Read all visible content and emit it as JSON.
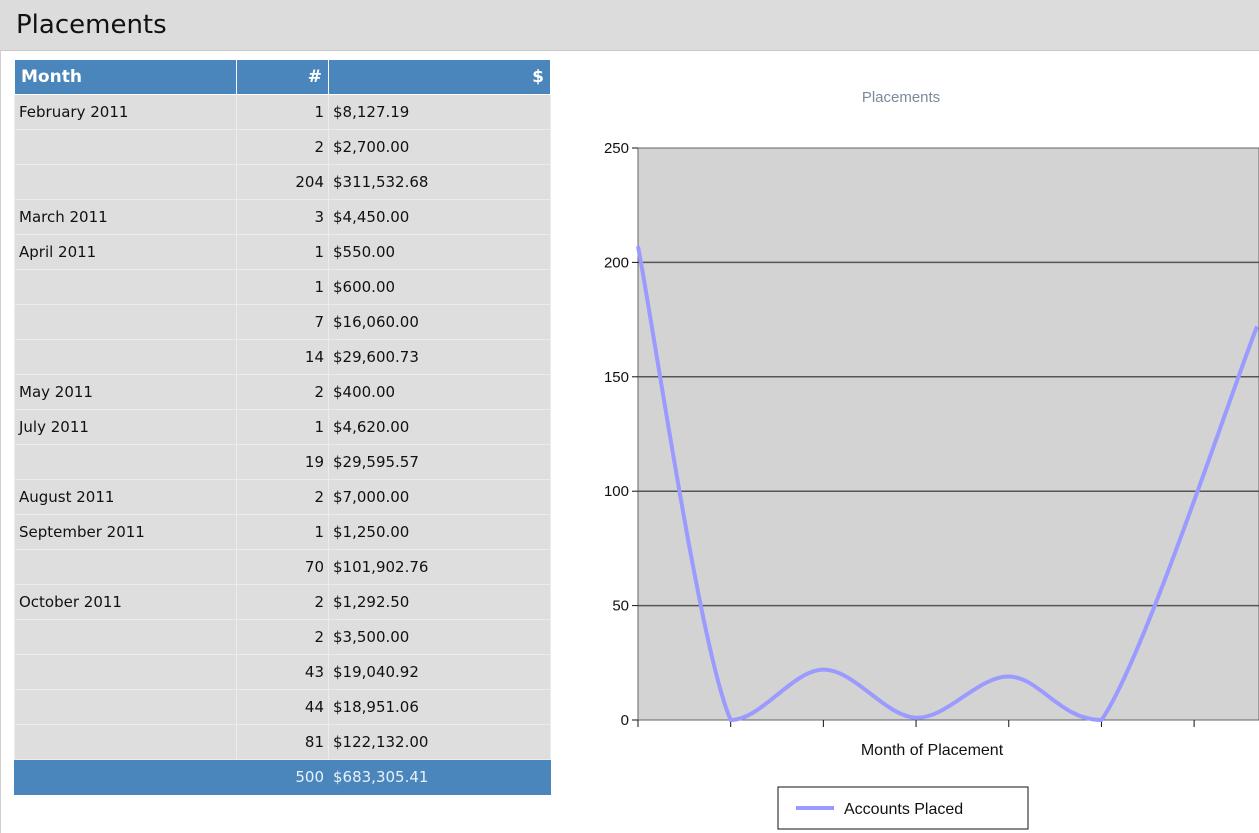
{
  "page": {
    "title": "Placements"
  },
  "table": {
    "headers": {
      "month": "Month",
      "count": "#",
      "amount": "$"
    },
    "rows": [
      {
        "month": "February 2011",
        "count": "1",
        "amount": "$8,127.19"
      },
      {
        "month": "",
        "count": "2",
        "amount": "$2,700.00"
      },
      {
        "month": "",
        "count": "204",
        "amount": "$311,532.68"
      },
      {
        "month": "March 2011",
        "count": "3",
        "amount": "$4,450.00"
      },
      {
        "month": "April 2011",
        "count": "1",
        "amount": "$550.00"
      },
      {
        "month": "",
        "count": "1",
        "amount": "$600.00"
      },
      {
        "month": "",
        "count": "7",
        "amount": "$16,060.00"
      },
      {
        "month": "",
        "count": "14",
        "amount": "$29,600.73"
      },
      {
        "month": "May 2011",
        "count": "2",
        "amount": "$400.00"
      },
      {
        "month": "July 2011",
        "count": "1",
        "amount": "$4,620.00"
      },
      {
        "month": "",
        "count": "19",
        "amount": "$29,595.57"
      },
      {
        "month": "August 2011",
        "count": "2",
        "amount": "$7,000.00"
      },
      {
        "month": "September 2011",
        "count": "1",
        "amount": "$1,250.00"
      },
      {
        "month": "",
        "count": "70",
        "amount": "$101,902.76"
      },
      {
        "month": "October 2011",
        "count": "2",
        "amount": "$1,292.50"
      },
      {
        "month": "",
        "count": "2",
        "amount": "$3,500.00"
      },
      {
        "month": "",
        "count": "43",
        "amount": "$19,040.92"
      },
      {
        "month": "",
        "count": "44",
        "amount": "$18,951.06"
      },
      {
        "month": "",
        "count": "81",
        "amount": "$122,132.00"
      }
    ],
    "total": {
      "count": "500",
      "amount": "$683,305.41"
    }
  },
  "chart_data": {
    "type": "line",
    "title": "Placements",
    "xlabel": "Month of Placement",
    "ylabel": "",
    "ylim": [
      0,
      250
    ],
    "yticks": [
      0,
      50,
      100,
      150,
      200,
      250
    ],
    "x_tick_count": 7,
    "grid": true,
    "legend_position": "bottom",
    "series": [
      {
        "name": "Accounts Placed",
        "values": [
          207,
          0,
          22,
          1,
          19,
          0,
          172
        ],
        "color": "#9a9aff"
      }
    ],
    "colors": {
      "plot_bg": "#d3d3d3",
      "title": "#7a8a9a",
      "gridline": "#555555"
    }
  }
}
